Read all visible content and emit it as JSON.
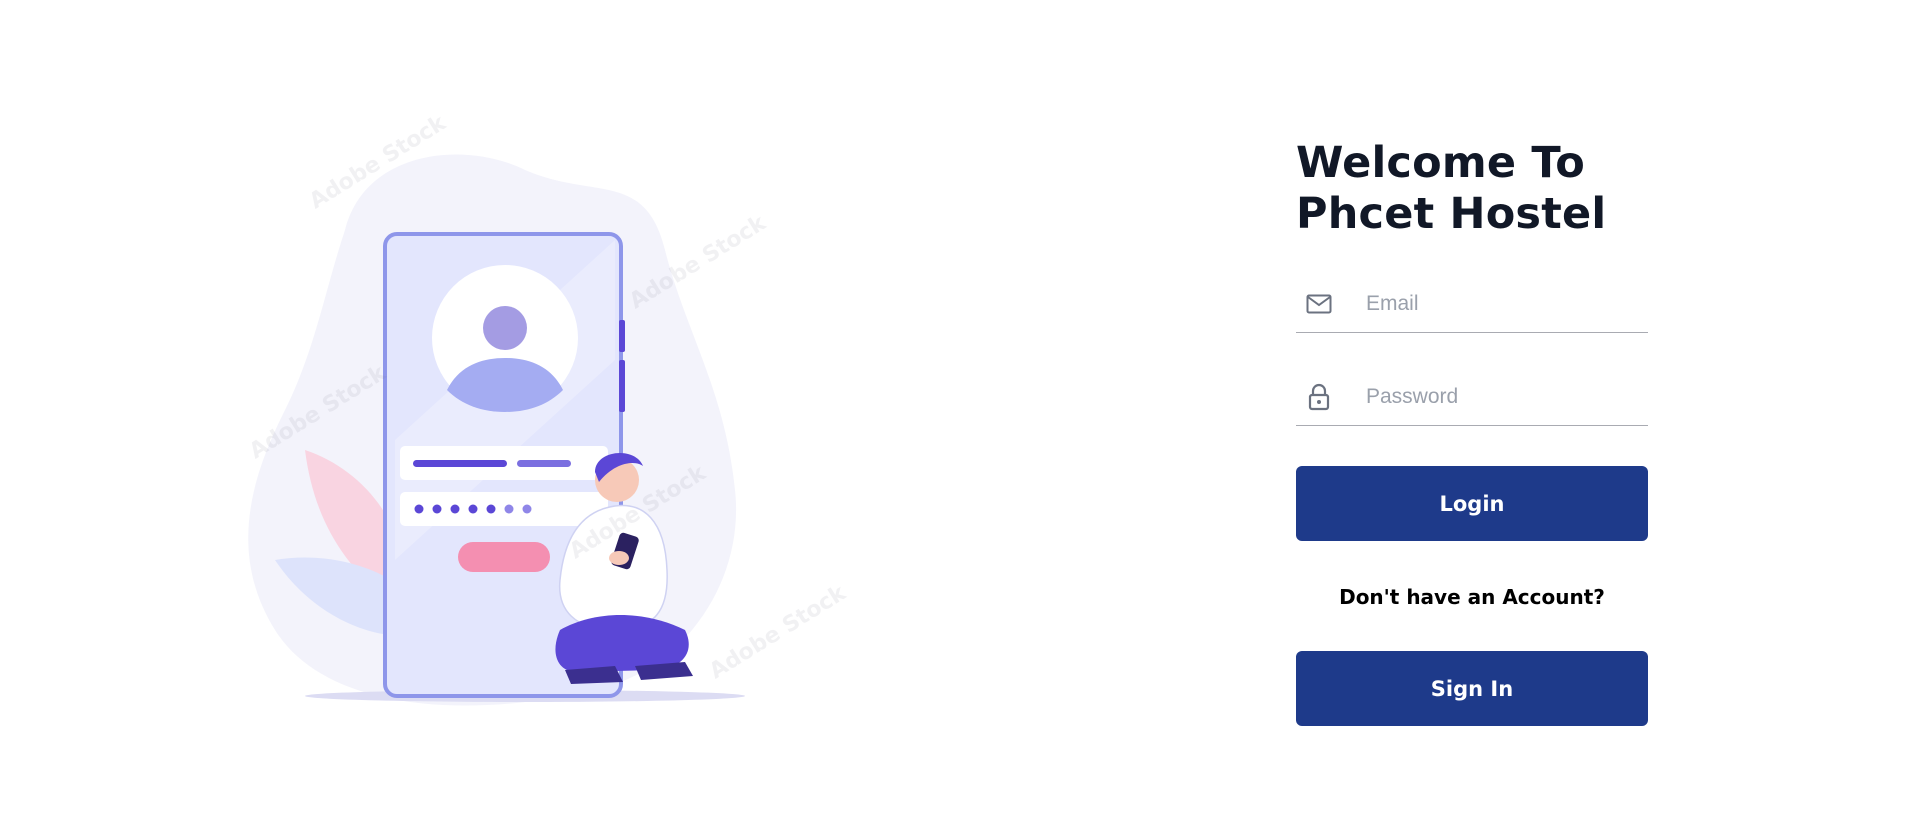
{
  "welcome": {
    "line1": "Welcome To",
    "line2": "Phcet Hostel"
  },
  "form": {
    "email": {
      "placeholder": "Email",
      "value": "",
      "icon": "mail-icon"
    },
    "password": {
      "placeholder": "Password",
      "value": "",
      "icon": "lock-icon"
    },
    "login_label": "Login",
    "signup_prompt": "Don't have an Account?",
    "signin_label": "Sign In"
  },
  "colors": {
    "button": "#1e3a8a",
    "title": "#111827",
    "illustration_purple": "#5b47d6",
    "illustration_pink": "#f48fb1"
  }
}
